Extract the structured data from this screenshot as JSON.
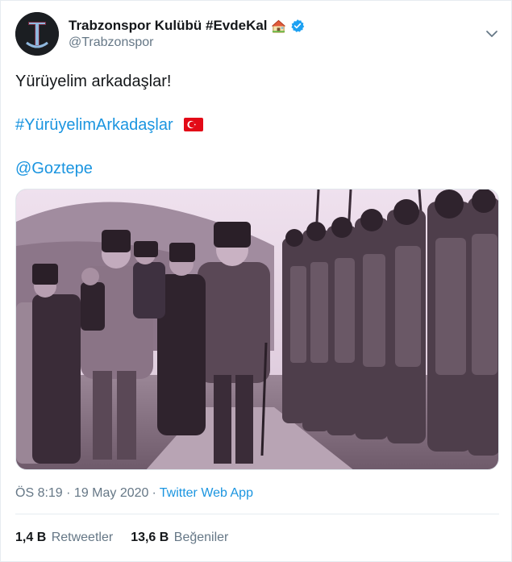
{
  "tweet": {
    "display_name": "Trabzonspor Kulübü #EvdeKal",
    "handle": "@Trabzonspor",
    "body_text": "Yürüyelim arkadaşlar!",
    "hashtag": "#YürüyelimArkadaşlar",
    "mention": "@Goztepe",
    "timestamp": "ÖS 8:19 · 19 May 2020",
    "separator": "·",
    "source": "Twitter Web App",
    "retweets_count": "1,4 B",
    "retweets_label": "Retweetler",
    "likes_count": "13,6 B",
    "likes_label": "Beğeniler"
  },
  "icons": {
    "verified": "verified-badge-icon",
    "house": "house-emoji-icon",
    "flag": "turkey-flag-emoji-icon",
    "caret": "chevron-down-icon"
  },
  "colors": {
    "link": "#1b95e0",
    "secondary_text": "#657786",
    "verified": "#1da1f2",
    "photo_tint": "#c9b8c6"
  }
}
